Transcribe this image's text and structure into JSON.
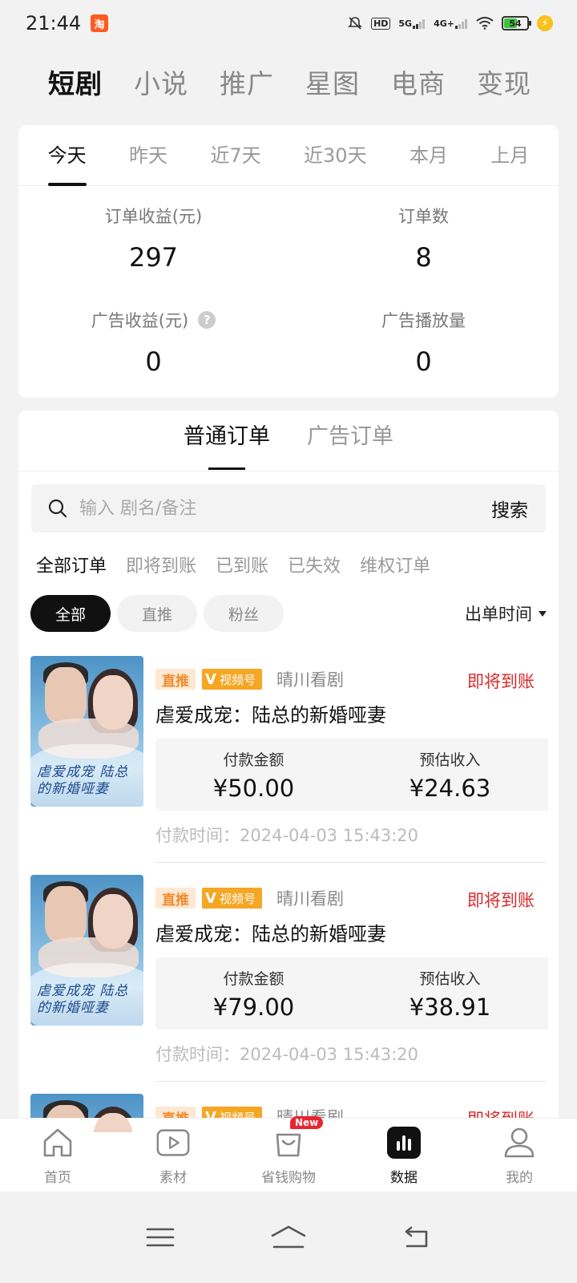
{
  "status_bar": {
    "time": "21:44",
    "app_badge": "淘",
    "hd_label": "HD",
    "net1": "5G",
    "net2": "4G+",
    "battery": "54"
  },
  "top_tabs": [
    {
      "label": "短剧",
      "active": true
    },
    {
      "label": "小说",
      "active": false
    },
    {
      "label": "推广",
      "active": false
    },
    {
      "label": "星图",
      "active": false
    },
    {
      "label": "电商",
      "active": false
    },
    {
      "label": "变现",
      "active": false
    }
  ],
  "date_tabs": [
    {
      "label": "今天",
      "active": true
    },
    {
      "label": "昨天",
      "active": false
    },
    {
      "label": "近7天",
      "active": false
    },
    {
      "label": "近30天",
      "active": false
    },
    {
      "label": "本月",
      "active": false
    },
    {
      "label": "上月",
      "active": false
    }
  ],
  "stats": {
    "order_income_label": "订单收益(元)",
    "order_income_value": "297",
    "order_count_label": "订单数",
    "order_count_value": "8",
    "ad_income_label": "广告收益(元)",
    "ad_income_value": "0",
    "ad_plays_label": "广告播放量",
    "ad_plays_value": "0",
    "help_glyph": "?"
  },
  "order_type_tabs": [
    {
      "label": "普通订单",
      "active": true
    },
    {
      "label": "广告订单",
      "active": false
    }
  ],
  "search": {
    "placeholder": "输入 剧名/备注",
    "button": "搜索"
  },
  "status_filters": [
    {
      "label": "全部订单",
      "active": true
    },
    {
      "label": "即将到账",
      "active": false
    },
    {
      "label": "已到账",
      "active": false
    },
    {
      "label": "已失效",
      "active": false
    },
    {
      "label": "维权订单",
      "active": false
    }
  ],
  "chips": [
    {
      "label": "全部",
      "active": true
    },
    {
      "label": "直推",
      "active": false
    },
    {
      "label": "粉丝",
      "active": false
    }
  ],
  "sort_label": "出单时间",
  "orders": [
    {
      "tag_direct": "直推",
      "tag_channel": "视频号",
      "studio": "晴川看剧",
      "status": "即将到账",
      "title": "虐爱成宠：陆总的新婚哑妻",
      "poster_text": "虐爱成宠 陆总的新婚哑妻",
      "pay_label": "付款金额",
      "pay_value": "¥50.00",
      "income_label": "预估收入",
      "income_value": "¥24.63",
      "time_label": "付款时间：",
      "time_value": "2024-04-03 15:43:20"
    },
    {
      "tag_direct": "直推",
      "tag_channel": "视频号",
      "studio": "晴川看剧",
      "status": "即将到账",
      "title": "虐爱成宠：陆总的新婚哑妻",
      "poster_text": "虐爱成宠 陆总的新婚哑妻",
      "pay_label": "付款金额",
      "pay_value": "¥79.00",
      "income_label": "预估收入",
      "income_value": "¥38.91",
      "time_label": "付款时间：",
      "time_value": "2024-04-03 15:43:20"
    },
    {
      "tag_direct": "直推",
      "tag_channel": "视频号",
      "studio": "晴川看剧",
      "status": "即将到账"
    }
  ],
  "bottom_nav": [
    {
      "label": "首页",
      "icon": "home-icon",
      "active": false
    },
    {
      "label": "素材",
      "icon": "play-icon",
      "active": false
    },
    {
      "label": "省钱购物",
      "icon": "shopping-bag-icon",
      "active": false,
      "badge": "New"
    },
    {
      "label": "数据",
      "icon": "bar-chart-icon",
      "active": true
    },
    {
      "label": "我的",
      "icon": "user-icon",
      "active": false
    }
  ],
  "colors": {
    "accent_red": "#d82a2a",
    "tag_orange": "#f5a623",
    "active_black": "#111111"
  }
}
